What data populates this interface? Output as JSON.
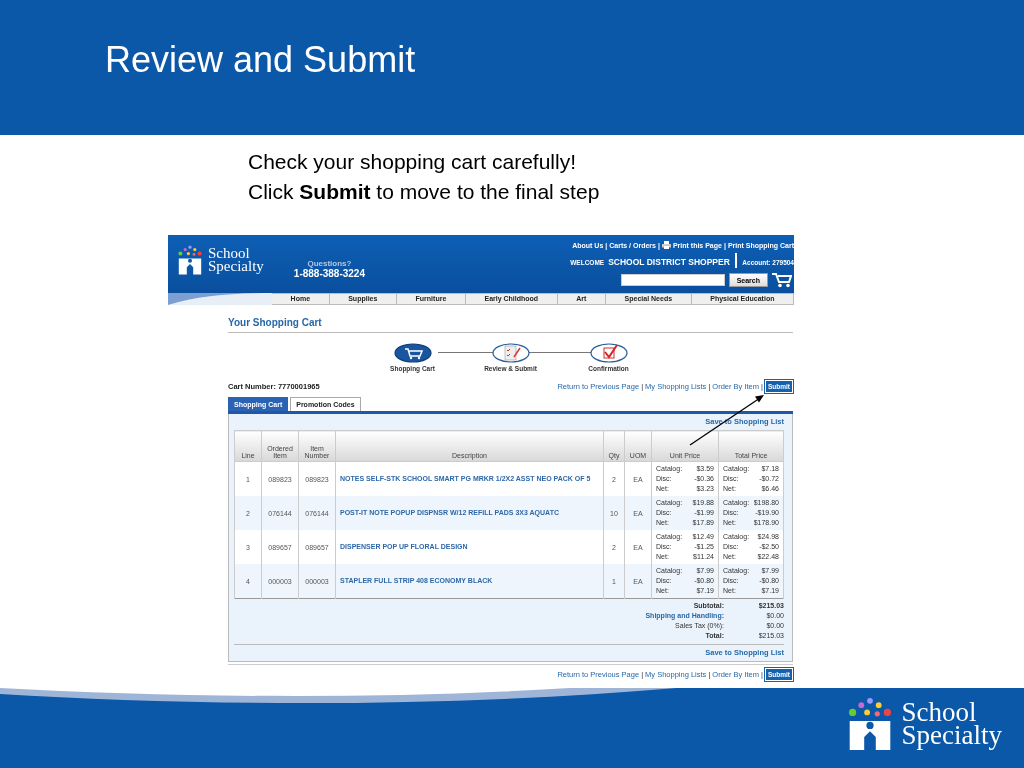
{
  "slide": {
    "title": "Review and Submit",
    "instructions": [
      "Check your shopping cart carefully!",
      "Click **Submit** to move to the final step"
    ],
    "footer_logo": [
      "School",
      "Specialty"
    ]
  },
  "site_header": {
    "logo": [
      "School",
      "Specialty"
    ],
    "questions": "Questions?",
    "phone": "1-888-388-3224",
    "top_links": [
      "About Us",
      "Carts / Orders",
      "Print this Page",
      "Print Shopping Cart"
    ],
    "separator": "|",
    "welcome": "WELCOME",
    "user": "SCHOOL DISTRICT SHOPPER",
    "account": "Account: 279504",
    "search_button": "Search"
  },
  "nav": [
    "Home",
    "Supplies",
    "Furniture",
    "Early Childhood",
    "Art",
    "Special Needs",
    "Physical Education"
  ],
  "cart": {
    "title": "Your Shopping Cart",
    "steps": [
      {
        "label": "Shopping Cart",
        "selected": true
      },
      {
        "label": "Review & Submit",
        "selected": false
      },
      {
        "label": "Confirmation",
        "selected": false
      }
    ],
    "separator": "|",
    "cart_number_label": "Cart Number:",
    "cart_number": "7770001965",
    "links": [
      "Return to Previous Page",
      "My Shopping Lists",
      "Order By Item"
    ],
    "submit": "Submit",
    "tabs": [
      {
        "label": "Shopping Cart",
        "selected": true
      },
      {
        "label": "Promotion Codes",
        "selected": false
      }
    ],
    "save_link": "Save to Shopping List",
    "columns": [
      "Line",
      "Ordered Item",
      "Item Number",
      "Description",
      "Qty",
      "UOM",
      "Unit Price",
      "Total Price"
    ],
    "rows": [
      {
        "line": "1",
        "ordered_item": "089823",
        "item_number": "089823",
        "description": "NOTES SELF-STK SCHOOL SMART PG MRKR 1/2X2 ASST NEO PACK OF 5",
        "qty": "2",
        "uom": "EA",
        "unit_price": [
          [
            "Catalog:",
            "$3.59"
          ],
          [
            "Disc:",
            "-$0.36"
          ],
          [
            "Net:",
            "$3.23"
          ]
        ],
        "total_price": [
          [
            "Catalog:",
            "$7.18"
          ],
          [
            "Disc:",
            "-$0.72"
          ],
          [
            "Net:",
            "$6.46"
          ]
        ]
      },
      {
        "line": "2",
        "ordered_item": "076144",
        "item_number": "076144",
        "description": "POST-IT NOTE POPUP DISPNSR W/12 REFILL PADS 3X3 AQUATC",
        "qty": "10",
        "uom": "EA",
        "unit_price": [
          [
            "Catalog:",
            "$19.88"
          ],
          [
            "Disc:",
            "-$1.99"
          ],
          [
            "Net:",
            "$17.89"
          ]
        ],
        "total_price": [
          [
            "Catalog:",
            "$198.80"
          ],
          [
            "Disc:",
            "-$19.90"
          ],
          [
            "Net:",
            "$178.90"
          ]
        ]
      },
      {
        "line": "3",
        "ordered_item": "089657",
        "item_number": "089657",
        "description": "DISPENSER POP UP FLORAL DESIGN",
        "qty": "2",
        "uom": "EA",
        "unit_price": [
          [
            "Catalog:",
            "$12.49"
          ],
          [
            "Disc:",
            "-$1.25"
          ],
          [
            "Net:",
            "$11.24"
          ]
        ],
        "total_price": [
          [
            "Catalog:",
            "$24.98"
          ],
          [
            "Disc:",
            "-$2.50"
          ],
          [
            "Net:",
            "$22.48"
          ]
        ]
      },
      {
        "line": "4",
        "ordered_item": "000003",
        "item_number": "000003",
        "description": "STAPLER FULL STRIP 408 ECONOMY BLACK",
        "qty": "1",
        "uom": "EA",
        "unit_price": [
          [
            "Catalog:",
            "$7.99"
          ],
          [
            "Disc:",
            "-$0.80"
          ],
          [
            "Net:",
            "$7.19"
          ]
        ],
        "total_price": [
          [
            "Catalog:",
            "$7.99"
          ],
          [
            "Disc:",
            "-$0.80"
          ],
          [
            "Net:",
            "$7.19"
          ]
        ]
      }
    ],
    "totals": [
      {
        "label": "Subtotal:",
        "value": "$215.03",
        "kind": "bold"
      },
      {
        "label": "Shipping and Handling:",
        "value": "$0.00",
        "kind": "link"
      },
      {
        "label": "Sales Tax (0%):",
        "value": "$0.00",
        "kind": "plain"
      },
      {
        "label": "Total:",
        "value": "$215.03",
        "kind": "total"
      }
    ],
    "save_link_bottom": "Save to Shopping List",
    "bottom_links": [
      "Return to Previous Page",
      "My Shopping Lists",
      "Order By Item"
    ],
    "bottom_submit": "Submit"
  }
}
